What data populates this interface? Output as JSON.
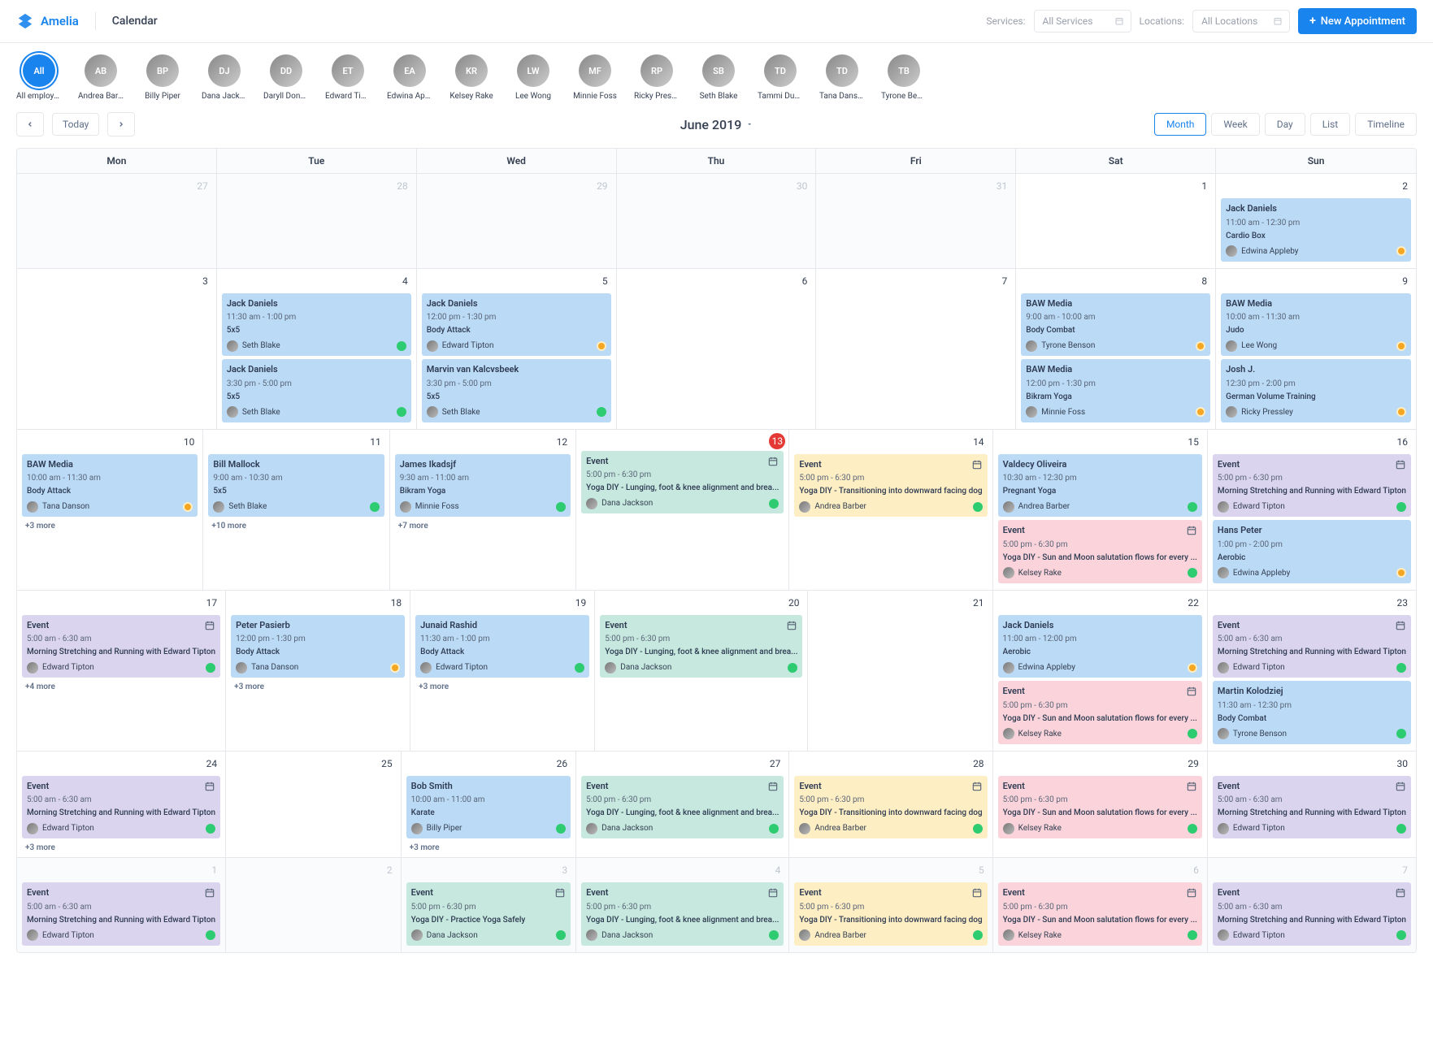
{
  "header": {
    "brand": "Amelia",
    "page_title": "Calendar",
    "services_label": "Services:",
    "services_placeholder": "All Services",
    "locations_label": "Locations:",
    "locations_placeholder": "All Locations",
    "new_appointment": "New Appointment"
  },
  "employees": [
    {
      "name": "All employees",
      "all": true,
      "initials": "All"
    },
    {
      "name": "Andrea Barber",
      "initials": "AB"
    },
    {
      "name": "Billy Piper",
      "initials": "BP"
    },
    {
      "name": "Dana Jackson",
      "initials": "DJ"
    },
    {
      "name": "Daryll Donov...",
      "initials": "DD"
    },
    {
      "name": "Edward Tipton",
      "initials": "ET"
    },
    {
      "name": "Edwina Appl...",
      "initials": "EA"
    },
    {
      "name": "Kelsey Rake",
      "initials": "KR"
    },
    {
      "name": "Lee Wong",
      "initials": "LW"
    },
    {
      "name": "Minnie Foss",
      "initials": "MF"
    },
    {
      "name": "Ricky Pressley",
      "initials": "RP"
    },
    {
      "name": "Seth Blake",
      "initials": "SB"
    },
    {
      "name": "Tammi Dukes",
      "initials": "TD"
    },
    {
      "name": "Tana Danson",
      "initials": "TD"
    },
    {
      "name": "Tyrone Benson",
      "initials": "TB"
    }
  ],
  "toolbar": {
    "today": "Today",
    "month_label": "June 2019",
    "views": [
      "Month",
      "Week",
      "Day",
      "List",
      "Timeline"
    ],
    "active_view": "Month"
  },
  "day_headers": [
    "Mon",
    "Tue",
    "Wed",
    "Thu",
    "Fri",
    "Sat",
    "Sun"
  ],
  "weeks": [
    {
      "days": [
        {
          "num": "27",
          "outside": true,
          "appts": []
        },
        {
          "num": "28",
          "outside": true,
          "appts": []
        },
        {
          "num": "29",
          "outside": true,
          "appts": []
        },
        {
          "num": "30",
          "outside": true,
          "appts": []
        },
        {
          "num": "31",
          "outside": true,
          "appts": []
        },
        {
          "num": "1",
          "appts": []
        },
        {
          "num": "2",
          "appts": [
            {
              "color": "blue",
              "title": "Jack Daniels",
              "time": "11:00 am - 12:30 pm",
              "service": "Cardio Box",
              "emp": "Edwina Appleby",
              "status": "pending"
            }
          ]
        }
      ]
    },
    {
      "days": [
        {
          "num": "3",
          "appts": []
        },
        {
          "num": "4",
          "appts": [
            {
              "color": "blue",
              "title": "Jack Daniels",
              "time": "11:30 am - 1:00 pm",
              "service": "5x5",
              "emp": "Seth Blake",
              "status": "approved"
            },
            {
              "color": "blue",
              "title": "Jack Daniels",
              "time": "3:30 pm - 5:00 pm",
              "service": "5x5",
              "emp": "Seth Blake",
              "status": "approved"
            }
          ]
        },
        {
          "num": "5",
          "appts": [
            {
              "color": "blue",
              "title": "Jack Daniels",
              "time": "12:00 pm - 1:30 pm",
              "service": "Body Attack",
              "emp": "Edward Tipton",
              "status": "pending"
            },
            {
              "color": "blue",
              "title": "Marvin van Kalcvsbeek",
              "time": "3:30 pm - 5:00 pm",
              "service": "5x5",
              "emp": "Seth Blake",
              "status": "approved"
            }
          ]
        },
        {
          "num": "6",
          "appts": []
        },
        {
          "num": "7",
          "appts": []
        },
        {
          "num": "8",
          "appts": [
            {
              "color": "blue",
              "title": "BAW Media",
              "time": "9:00 am - 10:00 am",
              "service": "Body Combat",
              "emp": "Tyrone Benson",
              "status": "pending"
            },
            {
              "color": "blue",
              "title": "BAW Media",
              "time": "12:00 pm - 1:30 pm",
              "service": "Bikram Yoga",
              "emp": "Minnie Foss",
              "status": "pending"
            }
          ]
        },
        {
          "num": "9",
          "appts": [
            {
              "color": "blue",
              "title": "BAW Media",
              "time": "10:00 am - 11:30 am",
              "service": "Judo",
              "emp": "Lee Wong",
              "status": "pending"
            },
            {
              "color": "blue",
              "title": "Josh J.",
              "time": "12:30 pm - 2:00 pm",
              "service": "German Volume Training",
              "emp": "Ricky Pressley",
              "status": "pending"
            }
          ]
        }
      ]
    },
    {
      "days": [
        {
          "num": "10",
          "appts": [
            {
              "color": "blue",
              "title": "BAW Media",
              "time": "10:00 am - 11:30 am",
              "service": "Body Attack",
              "emp": "Tana Danson",
              "status": "pending"
            }
          ],
          "more": "+3 more"
        },
        {
          "num": "11",
          "appts": [
            {
              "color": "blue",
              "title": "Bill Mallock",
              "time": "9:00 am - 10:30 am",
              "service": "5x5",
              "emp": "Seth Blake",
              "status": "approved"
            }
          ],
          "more": "+10 more"
        },
        {
          "num": "12",
          "appts": [
            {
              "color": "blue",
              "title": "James Ikadsjf",
              "time": "9:30 am - 11:00 am",
              "service": "Bikram Yoga",
              "emp": "Minnie Foss",
              "status": "approved"
            }
          ],
          "more": "+7 more"
        },
        {
          "num": "13",
          "today": true,
          "appts": [
            {
              "color": "teal",
              "title": "Event",
              "event": true,
              "time": "5:00 pm - 6:30 pm",
              "service": "Yoga DIY - Lunging, foot & knee alignment and brea...",
              "emp": "Dana Jackson",
              "status": "approved"
            }
          ]
        },
        {
          "num": "14",
          "appts": [
            {
              "color": "yellow",
              "title": "Event",
              "event": true,
              "time": "5:00 pm - 6:30 pm",
              "service": "Yoga DIY - Transitioning into downward facing dog",
              "emp": "Andrea Barber",
              "status": "approved"
            }
          ]
        },
        {
          "num": "15",
          "appts": [
            {
              "color": "blue",
              "title": "Valdecy Oliveira",
              "time": "10:30 am - 12:30 pm",
              "service": "Pregnant Yoga",
              "emp": "Andrea Barber",
              "status": "approved"
            },
            {
              "color": "pink",
              "title": "Event",
              "event": true,
              "time": "5:00 pm - 6:30 pm",
              "service": "Yoga DIY - Sun and Moon salutation flows for every ...",
              "emp": "Kelsey Rake",
              "status": "approved"
            }
          ]
        },
        {
          "num": "16",
          "appts": [
            {
              "color": "purple",
              "title": "Event",
              "event": true,
              "time": "5:00 pm - 6:30 pm",
              "service": "Morning Stretching and Running with Edward Tipton",
              "emp": "Edward Tipton",
              "status": "approved"
            },
            {
              "color": "blue",
              "title": "Hans Peter",
              "time": "1:00 pm - 2:00 pm",
              "service": "Aerobic",
              "emp": "Edwina Appleby",
              "status": "pending"
            }
          ]
        }
      ]
    },
    {
      "days": [
        {
          "num": "17",
          "appts": [
            {
              "color": "purple",
              "title": "Event",
              "event": true,
              "time": "5:00 am - 6:30 am",
              "service": "Morning Stretching and Running with Edward Tipton",
              "emp": "Edward Tipton",
              "status": "approved"
            }
          ],
          "more": "+4 more"
        },
        {
          "num": "18",
          "appts": [
            {
              "color": "blue",
              "title": "Peter Pasierb",
              "time": "12:00 pm - 1:30 pm",
              "service": "Body Attack",
              "emp": "Tana Danson",
              "status": "pending"
            }
          ],
          "more": "+3 more"
        },
        {
          "num": "19",
          "appts": [
            {
              "color": "blue",
              "title": "Junaid Rashid",
              "time": "11:30 am - 1:00 pm",
              "service": "Body Attack",
              "emp": "Edward Tipton",
              "status": "approved"
            }
          ],
          "more": "+3 more"
        },
        {
          "num": "20",
          "appts": [
            {
              "color": "teal",
              "title": "Event",
              "event": true,
              "time": "5:00 pm - 6:30 pm",
              "service": "Yoga DIY - Lunging, foot & knee alignment and brea...",
              "emp": "Dana Jackson",
              "status": "approved"
            }
          ]
        },
        {
          "num": "21",
          "appts": []
        },
        {
          "num": "22",
          "appts": [
            {
              "color": "blue",
              "title": "Jack Daniels",
              "time": "11:00 am - 12:00 pm",
              "service": "Aerobic",
              "emp": "Edwina Appleby",
              "status": "pending"
            },
            {
              "color": "pink",
              "title": "Event",
              "event": true,
              "time": "5:00 pm - 6:30 pm",
              "service": "Yoga DIY - Sun and Moon salutation flows for every ...",
              "emp": "Kelsey Rake",
              "status": "approved"
            }
          ]
        },
        {
          "num": "23",
          "appts": [
            {
              "color": "purple",
              "title": "Event",
              "event": true,
              "time": "5:00 am - 6:30 am",
              "service": "Morning Stretching and Running with Edward Tipton",
              "emp": "Edward Tipton",
              "status": "approved"
            },
            {
              "color": "blue",
              "title": "Martin Kolodziej",
              "time": "11:30 am - 12:30 pm",
              "service": "Body Combat",
              "emp": "Tyrone Benson",
              "status": "approved"
            }
          ]
        }
      ]
    },
    {
      "days": [
        {
          "num": "24",
          "appts": [
            {
              "color": "purple",
              "title": "Event",
              "event": true,
              "time": "5:00 am - 6:30 am",
              "service": "Morning Stretching and Running with Edward Tipton",
              "emp": "Edward Tipton",
              "status": "approved"
            }
          ],
          "more": "+3 more"
        },
        {
          "num": "25",
          "appts": []
        },
        {
          "num": "26",
          "appts": [
            {
              "color": "blue",
              "title": "Bob Smith",
              "time": "10:00 am - 11:00 am",
              "service": "Karate",
              "emp": "Billy Piper",
              "status": "approved"
            }
          ],
          "more": "+3 more"
        },
        {
          "num": "27",
          "appts": [
            {
              "color": "teal",
              "title": "Event",
              "event": true,
              "time": "5:00 pm - 6:30 pm",
              "service": "Yoga DIY - Lunging, foot & knee alignment and brea...",
              "emp": "Dana Jackson",
              "status": "approved"
            }
          ]
        },
        {
          "num": "28",
          "appts": [
            {
              "color": "yellow",
              "title": "Event",
              "event": true,
              "time": "5:00 pm - 6:30 pm",
              "service": "Yoga DIY - Transitioning into downward facing dog",
              "emp": "Andrea Barber",
              "status": "approved"
            }
          ]
        },
        {
          "num": "29",
          "appts": [
            {
              "color": "pink",
              "title": "Event",
              "event": true,
              "time": "5:00 pm - 6:30 pm",
              "service": "Yoga DIY - Sun and Moon salutation flows for every ...",
              "emp": "Kelsey Rake",
              "status": "approved"
            }
          ]
        },
        {
          "num": "30",
          "appts": [
            {
              "color": "purple",
              "title": "Event",
              "event": true,
              "time": "5:00 am - 6:30 am",
              "service": "Morning Stretching and Running with Edward Tipton",
              "emp": "Edward Tipton",
              "status": "approved"
            }
          ]
        }
      ]
    },
    {
      "days": [
        {
          "num": "1",
          "outside": true,
          "appts": [
            {
              "color": "purple",
              "title": "Event",
              "event": true,
              "time": "5:00 am - 6:30 am",
              "service": "Morning Stretching and Running with Edward Tipton",
              "emp": "Edward Tipton",
              "status": "approved"
            }
          ]
        },
        {
          "num": "2",
          "outside": true,
          "appts": []
        },
        {
          "num": "3",
          "outside": true,
          "appts": [
            {
              "color": "teal",
              "title": "Event",
              "event": true,
              "time": "5:00 pm - 6:30 pm",
              "service": "Yoga DIY - Practice Yoga Safely",
              "emp": "Dana Jackson",
              "status": "approved"
            }
          ]
        },
        {
          "num": "4",
          "outside": true,
          "appts": [
            {
              "color": "teal",
              "title": "Event",
              "event": true,
              "time": "5:00 pm - 6:30 pm",
              "service": "Yoga DIY - Lunging, foot & knee alignment and brea...",
              "emp": "Dana Jackson",
              "status": "approved"
            }
          ]
        },
        {
          "num": "5",
          "outside": true,
          "appts": [
            {
              "color": "yellow",
              "title": "Event",
              "event": true,
              "time": "5:00 pm - 6:30 pm",
              "service": "Yoga DIY - Transitioning into downward facing dog",
              "emp": "Andrea Barber",
              "status": "approved"
            }
          ]
        },
        {
          "num": "6",
          "outside": true,
          "appts": [
            {
              "color": "pink",
              "title": "Event",
              "event": true,
              "time": "5:00 pm - 6:30 pm",
              "service": "Yoga DIY - Sun and Moon salutation flows for every ...",
              "emp": "Kelsey Rake",
              "status": "approved"
            }
          ]
        },
        {
          "num": "7",
          "outside": true,
          "appts": [
            {
              "color": "purple",
              "title": "Event",
              "event": true,
              "time": "5:00 am - 6:30 am",
              "service": "Morning Stretching and Running with Edward Tipton",
              "emp": "Edward Tipton",
              "status": "approved"
            }
          ]
        }
      ]
    }
  ]
}
